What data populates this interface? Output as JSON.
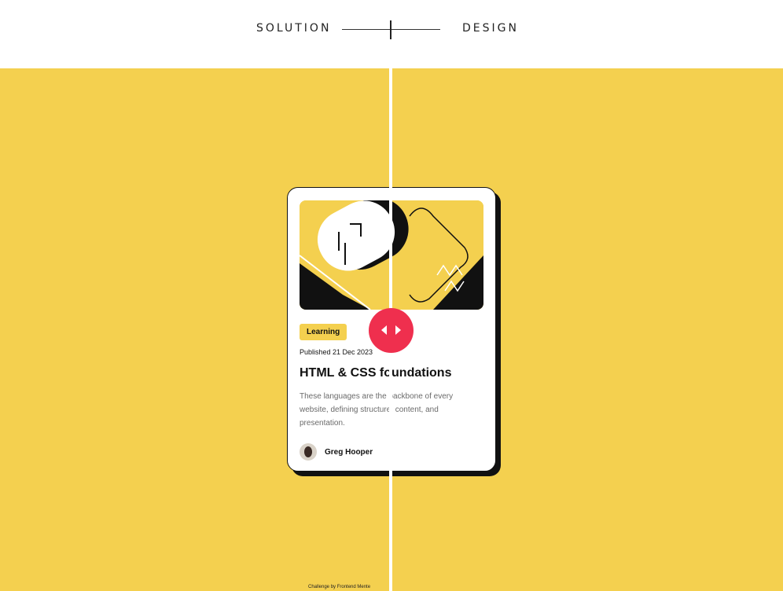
{
  "toggle": {
    "left_label": "SOLUTION",
    "right_label": "DESIGN"
  },
  "card": {
    "tag": "Learning",
    "published": "Published 21 Dec 2023",
    "title": "HTML & CSS foundations",
    "description": "These languages are the backbone of every website, defining structure, content, and presentation.",
    "author": "Greg Hooper"
  },
  "footer": {
    "attribution": "Challenge by Frontend Mente"
  },
  "colors": {
    "background": "#f4d04f",
    "handle": "#ef2f4e"
  },
  "icons": {
    "handle": "left-right-arrows-icon"
  }
}
